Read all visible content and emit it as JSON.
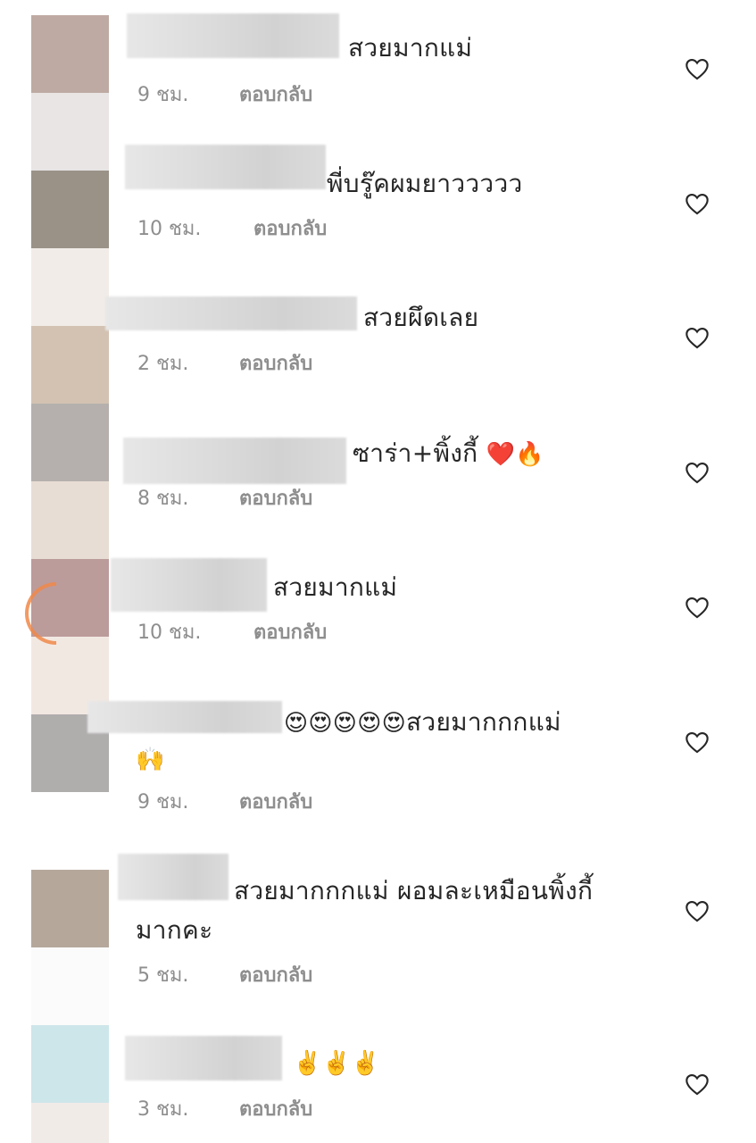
{
  "comments": [
    {
      "text": "สวยมากแม่",
      "time": "9 ชม.",
      "reply": "ตอบกลับ"
    },
    {
      "text": "พี่บรู๊คผมยาววววว",
      "time": "10 ชม.",
      "reply": "ตอบกลับ"
    },
    {
      "text": "สวยผึดเลย",
      "time": "2 ชม.",
      "reply": "ตอบกลับ"
    },
    {
      "text": "ซาร่า+พิ้งกี้",
      "emoji": "❤️🔥",
      "time": "8 ชม.",
      "reply": "ตอบกลับ"
    },
    {
      "text": "สวยมากแม่",
      "time": "10 ชม.",
      "reply": "ตอบกลับ"
    },
    {
      "emoji_prefix": "😍😍😍😍😍",
      "text": "สวยมากกกแม่",
      "emoji_line2": "🙌",
      "time": "9 ชม.",
      "reply": "ตอบกลับ"
    },
    {
      "text": "สวยมากกกแม่ ผอมละเหมือนพิ้งกี้",
      "text_line2": "มากคะ",
      "time": "5 ชม.",
      "reply": "ตอบกลับ"
    },
    {
      "emoji": "✌️✌️✌️",
      "time": "3 ชม.",
      "reply": "ตอบกลับ"
    }
  ],
  "colors": {
    "text": "#262626",
    "meta": "#8e8e8e",
    "heart": "#262626",
    "ring": "#f0894a",
    "avatar_strip": [
      "#bfaaa3",
      "#e8e5e4",
      "#9a9287",
      "#f2ece8",
      "#d3c2b2",
      "#b5b0ad",
      "#e7ddd4",
      "#bc9b9b",
      "#f2e8e2",
      "#b0adad",
      "#b5a89b",
      "#fbfbfb",
      "#cde6ea",
      "#f1ebe7"
    ]
  },
  "icons": {
    "like": "heart-outline-icon"
  }
}
